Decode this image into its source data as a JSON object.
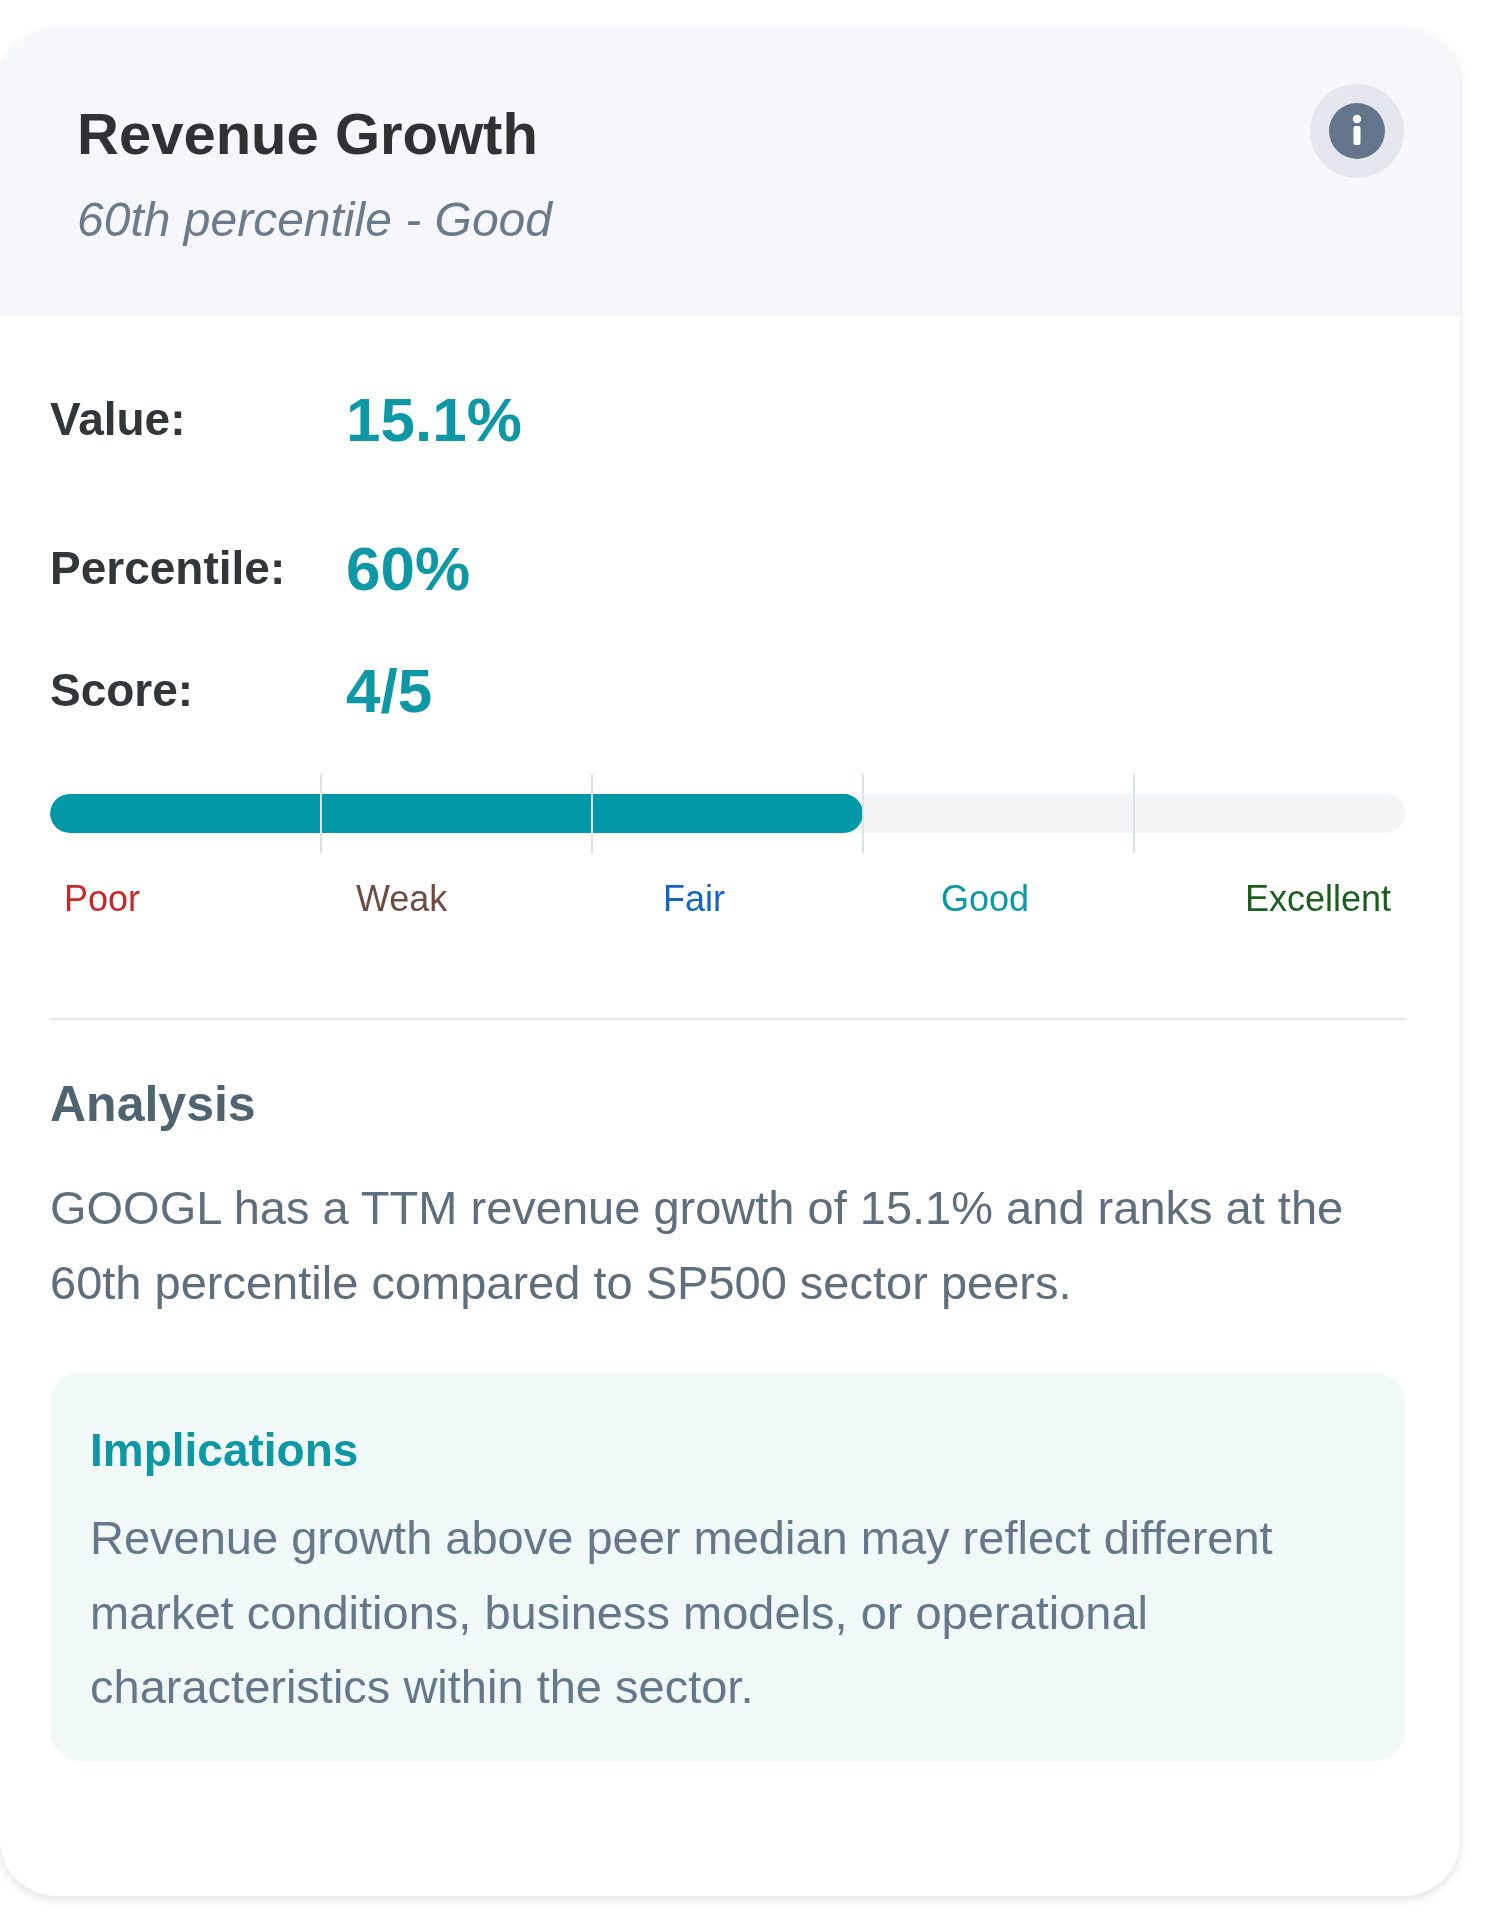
{
  "card": {
    "title": "Revenue Growth",
    "subtitle": "60th percentile - Good"
  },
  "metrics": [
    {
      "label": "Value:",
      "value": "15.1%"
    },
    {
      "label": "Percentile:",
      "value": "60%"
    },
    {
      "label": "Score:",
      "value": "4/5"
    }
  ],
  "scale": {
    "level": 0.6,
    "labels": [
      {
        "text": "Poor",
        "color": "#c62828"
      },
      {
        "text": "Weak",
        "color": "#6d4c41"
      },
      {
        "text": "Fair",
        "color": "#1565c0"
      },
      {
        "text": "Good",
        "color": "#0e97a4"
      },
      {
        "text": "Excellent",
        "color": "#1b5e20"
      }
    ]
  },
  "analysis": {
    "heading": "Analysis",
    "text": "GOOGL has a TTM revenue growth of 15.1% and ranks at the 60th percentile compared to SP500 sector peers."
  },
  "implications": {
    "heading": "Implications",
    "text": "Revenue growth above peer median may reflect different market conditions, business models, or operational characteristics within the sector."
  }
}
